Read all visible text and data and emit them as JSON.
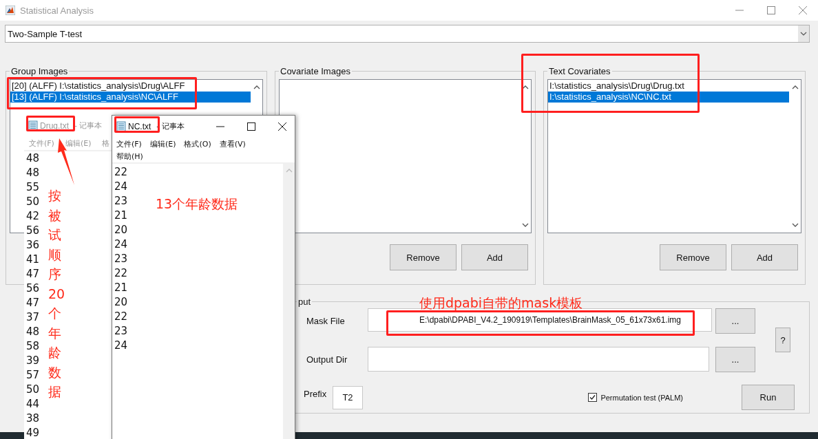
{
  "window": {
    "title": "Statistical Analysis"
  },
  "test_type": {
    "value": "Two-Sample T-test"
  },
  "panels": [
    {
      "title": "Group Images",
      "items": [
        {
          "text": "[20] (ALFF) I:\\statistics_analysis\\Drug\\ALFF",
          "selected": false
        },
        {
          "text": "[13] (ALFF) I:\\statistics_analysis\\NC\\ALFF",
          "selected": true
        }
      ]
    },
    {
      "title": "Covariate Images",
      "buttons": [
        "Remove",
        "Add"
      ]
    },
    {
      "title": "Text Covariates",
      "items": [
        {
          "text": "I:\\statistics_analysis\\Drug\\Drug.txt",
          "selected": false
        },
        {
          "text": "I:\\statistics_analysis\\NC\\NC.txt",
          "selected": true
        }
      ],
      "buttons": [
        "Remove",
        "Add"
      ]
    }
  ],
  "output": {
    "legend": "put",
    "mask_label": "Mask File",
    "mask_value": "E:\\dpabi\\DPABI_V4.2_190919\\Templates\\BrainMask_05_61x73x61.img",
    "mask_browse": "...",
    "output_label": "Output Dir",
    "output_browse": "...",
    "help": "?",
    "prefix_label": "Prefix",
    "prefix_value": "T2",
    "permutation": {
      "label": "Permutation test (PALM)",
      "checked": true
    },
    "run": "Run"
  },
  "notepads": [
    {
      "file": "Drug.txt",
      "app": "- 记事本",
      "active": false,
      "menu": [
        "文件(F)",
        "编辑(E)",
        "格"
      ],
      "lines": [
        "48",
        "48",
        "55",
        "50",
        "42",
        "56",
        "36",
        "41",
        "47",
        "56",
        "47",
        "37",
        "48",
        "58",
        "39",
        "57",
        "50",
        "44",
        "38",
        "49"
      ]
    },
    {
      "file": "NC.txt",
      "app": "- 记事本",
      "active": true,
      "menu": [
        "文件(F)",
        "编辑(E)",
        "格式(O)",
        "查看(V)"
      ],
      "menu_row2": [
        "帮助(H)"
      ],
      "lines": [
        "22",
        "24",
        "23",
        "21",
        "20",
        "24",
        "23",
        "22",
        "21",
        "20",
        "22",
        "23",
        "24"
      ]
    }
  ],
  "annotations": [
    "按被试顺序20个年龄数据",
    "13个年龄数据",
    "使用dpabi自带的mask模板"
  ]
}
